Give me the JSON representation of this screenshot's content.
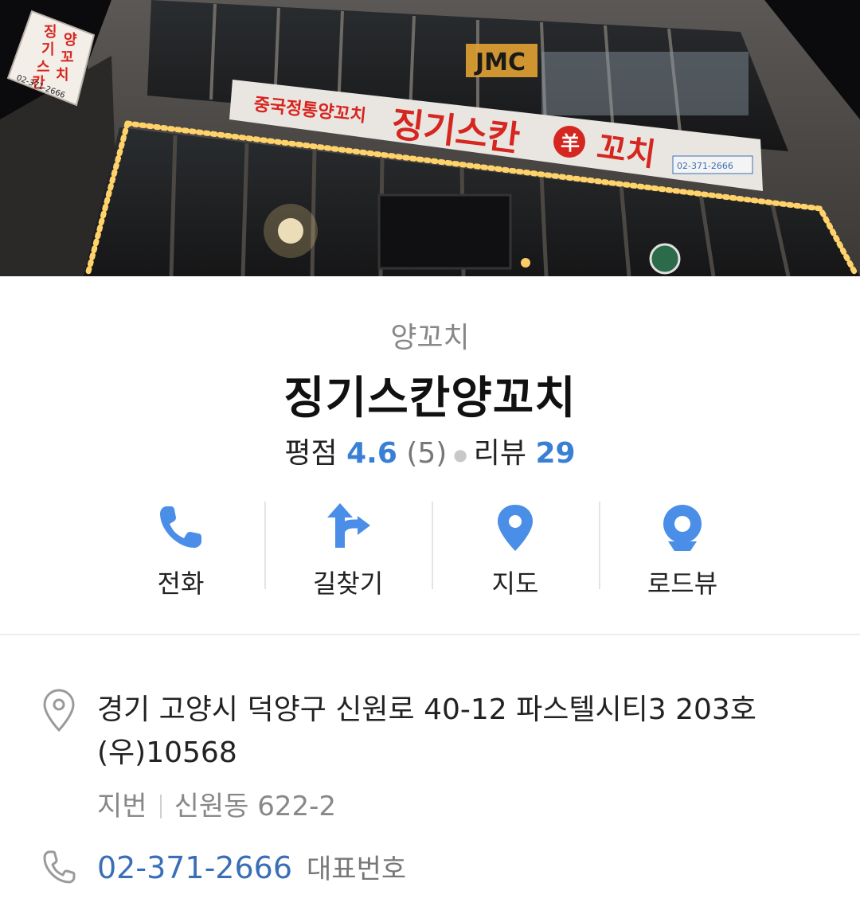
{
  "photo": {
    "caption": "storefront photo",
    "sign_small_top": "중국정통양꼬치",
    "sign_main": "징기스칸",
    "sign_main_tail": "꼬치",
    "sign_badge": "羊",
    "upper_sign": "JMC",
    "sign_phone": "02-371-2666",
    "vertical_sign": [
      "징",
      "기",
      "스",
      "칸",
      "양",
      "꼬",
      "치"
    ],
    "vertical_sign_phone": "02-371-2666"
  },
  "place": {
    "category": "양꼬치",
    "name": "징기스칸양꼬치",
    "rating_label": "평점",
    "rating_value": "4.6",
    "rating_count": "(5)",
    "review_label": "리뷰",
    "review_count": "29"
  },
  "actions": [
    {
      "label": "전화",
      "icon": "phone-icon"
    },
    {
      "label": "길찾기",
      "icon": "directions-icon"
    },
    {
      "label": "지도",
      "icon": "map-pin-icon"
    },
    {
      "label": "로드뷰",
      "icon": "roadview-icon"
    }
  ],
  "info": {
    "address_line1": "경기 고양시 덕양구 신원로 40-12 파스텔시티3 203호",
    "address_line2": "(우)10568",
    "jibun_label": "지번",
    "jibun_value": "신원동 622-2",
    "phone_number": "02-371-2666",
    "phone_tag": "대표번호"
  },
  "colors": {
    "accent_blue": "#3a7fd6",
    "icon_blue": "#4a8ee8",
    "text_grey": "#888888"
  }
}
